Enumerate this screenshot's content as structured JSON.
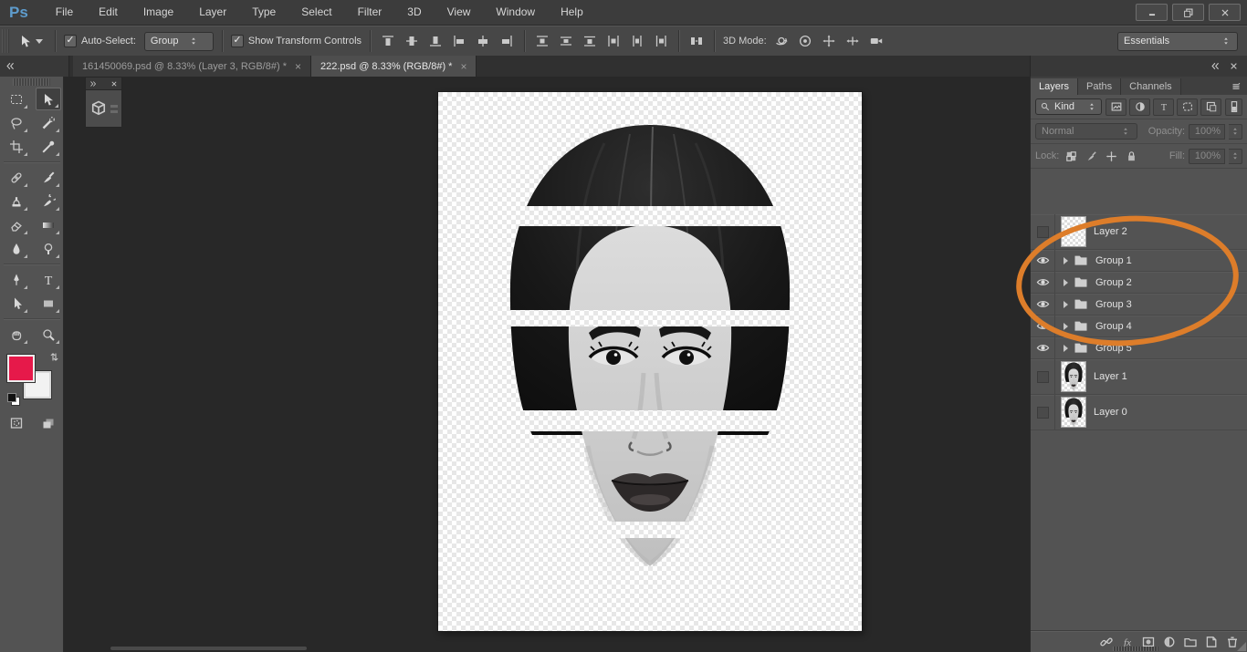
{
  "window": {
    "app_logo": "Ps",
    "controls": [
      {
        "name": "minimize"
      },
      {
        "name": "restore"
      },
      {
        "name": "close"
      }
    ]
  },
  "menu_bar": {
    "items": [
      "File",
      "Edit",
      "Image",
      "Layer",
      "Type",
      "Select",
      "Filter",
      "3D",
      "View",
      "Window",
      "Help"
    ]
  },
  "options_bar": {
    "active_tool_icon": "move-tool",
    "auto_select_label": "Auto-Select:",
    "auto_select_checked": true,
    "auto_select_value": "Group",
    "show_transform_label": "Show Transform Controls",
    "show_transform_checked": true,
    "align_icons": [
      "align-top-edges",
      "align-vertical-centers",
      "align-bottom-edges",
      "align-left-edges",
      "align-horizontal-centers",
      "align-right-edges"
    ],
    "distribute_icons": [
      "distribute-top-edges",
      "distribute-vertical-centers",
      "distribute-bottom-edges",
      "distribute-left-edges",
      "distribute-horizontal-centers",
      "distribute-right-edges"
    ],
    "spacing_icon": "distribute-spacing",
    "mode_label": "3D Mode:",
    "mode_icons": [
      "3d-orbit",
      "3d-roll",
      "3d-drag",
      "3d-slide",
      "3d-camera"
    ],
    "workspace_value": "Essentials",
    "checkmark": "✓"
  },
  "document_tabs": [
    {
      "title": "161450069.psd @ 8.33% (Layer 3, RGB/8#) *",
      "close": "×",
      "active": false
    },
    {
      "title": "222.psd @ 8.33% (RGB/8#) *",
      "close": "×",
      "active": true
    }
  ],
  "toolbar": {
    "tools": [
      {
        "name": "rectangular-marquee",
        "selected": false
      },
      {
        "name": "move",
        "selected": true
      },
      {
        "name": "lasso",
        "selected": false
      },
      {
        "name": "quick-selection",
        "selected": false
      },
      {
        "name": "crop",
        "selected": false
      },
      {
        "name": "eyedropper",
        "selected": false
      },
      {
        "name": "spot-healing-brush",
        "selected": false
      },
      {
        "name": "brush",
        "selected": false
      },
      {
        "name": "clone-stamp",
        "selected": false
      },
      {
        "name": "history-brush",
        "selected": false
      },
      {
        "name": "eraser",
        "selected": false
      },
      {
        "name": "gradient",
        "selected": false
      },
      {
        "name": "blur",
        "selected": false
      },
      {
        "name": "dodge",
        "selected": false
      },
      {
        "name": "pen",
        "selected": false
      },
      {
        "name": "type",
        "selected": false
      },
      {
        "name": "path-selection",
        "selected": false
      },
      {
        "name": "rectangle-shape",
        "selected": false
      },
      {
        "name": "hand",
        "selected": false
      },
      {
        "name": "zoom",
        "selected": false
      }
    ],
    "separators_after": [
      5,
      13,
      17
    ],
    "foreground_color": "#e6194a",
    "background_color": "#f2f2f2"
  },
  "layers_panel": {
    "tabs": [
      {
        "label": "Layers",
        "active": true
      },
      {
        "label": "Paths",
        "active": false
      },
      {
        "label": "Channels",
        "active": false
      }
    ],
    "filter": {
      "kind_label": "Kind",
      "filter_icons": [
        "filter-pixel",
        "filter-adjustment",
        "filter-type",
        "filter-shape",
        "filter-smart"
      ]
    },
    "blend_mode_value": "Normal",
    "opacity_label": "Opacity:",
    "opacity_value": "100%",
    "lock_label": "Lock:",
    "lock_icons": [
      "lock-transparency",
      "lock-pixels",
      "lock-position",
      "lock-all"
    ],
    "fill_label": "Fill:",
    "fill_value": "100%",
    "layers": [
      {
        "name": "Layer 2",
        "kind": "layer",
        "visible": false,
        "thumb": "checker"
      },
      {
        "name": "Group 1",
        "kind": "group",
        "visible": true
      },
      {
        "name": "Group 2",
        "kind": "group",
        "visible": true
      },
      {
        "name": "Group 3",
        "kind": "group",
        "visible": true
      },
      {
        "name": "Group 4",
        "kind": "group",
        "visible": true
      },
      {
        "name": "Group 5",
        "kind": "group",
        "visible": true
      },
      {
        "name": "Layer 1",
        "kind": "layer",
        "visible": false,
        "thumb": "face"
      },
      {
        "name": "Layer 0",
        "kind": "layer",
        "visible": false,
        "thumb": "face"
      }
    ],
    "bottom_icons": [
      "link-layers",
      "layer-effects",
      "add-mask",
      "adjustment-layer",
      "new-group",
      "new-layer",
      "delete-layer"
    ],
    "annotation_color": "#dd7d2a"
  }
}
